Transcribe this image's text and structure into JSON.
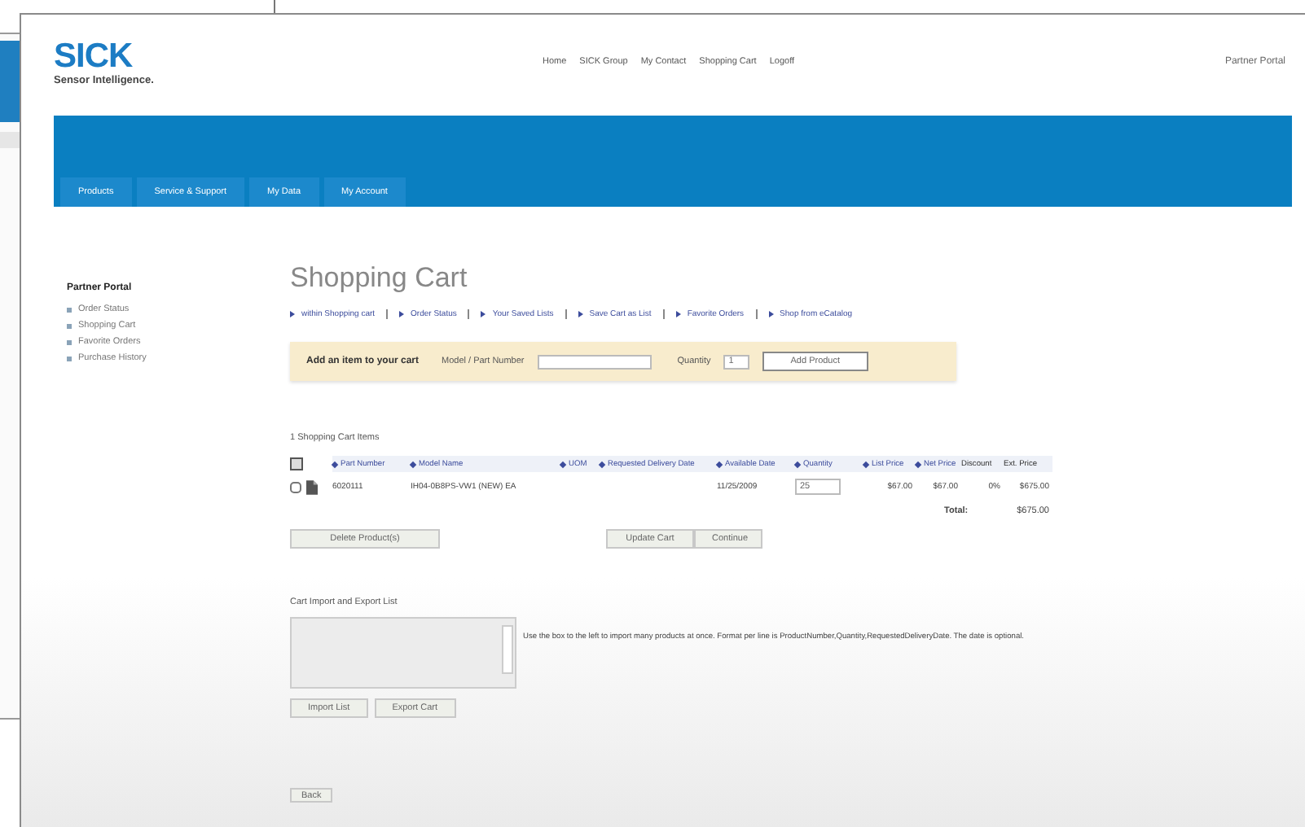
{
  "header": {
    "logo": "SICK",
    "tagline": "Sensor Intelligence.",
    "top_nav": [
      "Home",
      "SICK Group",
      "My Contact",
      "Shopping Cart",
      "Logoff"
    ],
    "portal_label": "Partner Portal"
  },
  "tabs": [
    {
      "label": "Products",
      "selected": false
    },
    {
      "label": "Service & Support",
      "selected": false
    },
    {
      "label": "My Data",
      "selected": false
    },
    {
      "label": "My Account",
      "selected": false
    }
  ],
  "sidebar": {
    "title": "Partner Portal",
    "items": [
      "Order Status",
      "Shopping Cart",
      "Favorite Orders",
      "Purchase History"
    ]
  },
  "page_title": "Shopping Cart",
  "links": [
    "within Shopping cart",
    "Order Status",
    "Your Saved Lists",
    "Save Cart as List",
    "Favorite Orders",
    "Shop from eCatalog"
  ],
  "add_bar": {
    "title": "Add an item to your cart",
    "part_label": "Model / Part Number",
    "quantity_label": "Quantity",
    "quantity_value": "1",
    "button": "Add Product"
  },
  "items_label": "1 Shopping Cart Items",
  "table": {
    "columns": [
      {
        "label": "Part Number",
        "sortable": true
      },
      {
        "label": "Model Name",
        "sortable": true
      },
      {
        "label": "UOM",
        "sortable": true
      },
      {
        "label": "Requested Delivery Date",
        "sortable": true
      },
      {
        "label": "Available Date",
        "sortable": true
      },
      {
        "label": "Quantity",
        "sortable": true
      },
      {
        "label": "List Price",
        "sortable": true
      },
      {
        "label": "Net Price",
        "sortable": true
      },
      {
        "label": "Discount",
        "sortable": false
      },
      {
        "label": "Ext. Price",
        "sortable": false
      }
    ],
    "rows": [
      {
        "checked": false,
        "cells": [
          "6020111",
          "IH04-0B8PS-VW1 (NEW) EA",
          "",
          "",
          "11/25/2009",
          "25",
          "$67.00",
          "$67.00",
          "0%",
          "$675.00"
        ]
      }
    ],
    "total_label": "Total:",
    "total_value": "$675.00"
  },
  "cart_buttons": [
    "Delete Product(s)",
    "Update Cart",
    "Continue"
  ],
  "import": {
    "title": "Cart Import and Export List",
    "help": "Use the box to the left to import many products at once. Format per line is ProductNumber,Quantity,RequestedDeliveryDate. The date is optional.",
    "buttons": [
      "Import List",
      "Export Cart"
    ]
  },
  "back_button": "Back"
}
